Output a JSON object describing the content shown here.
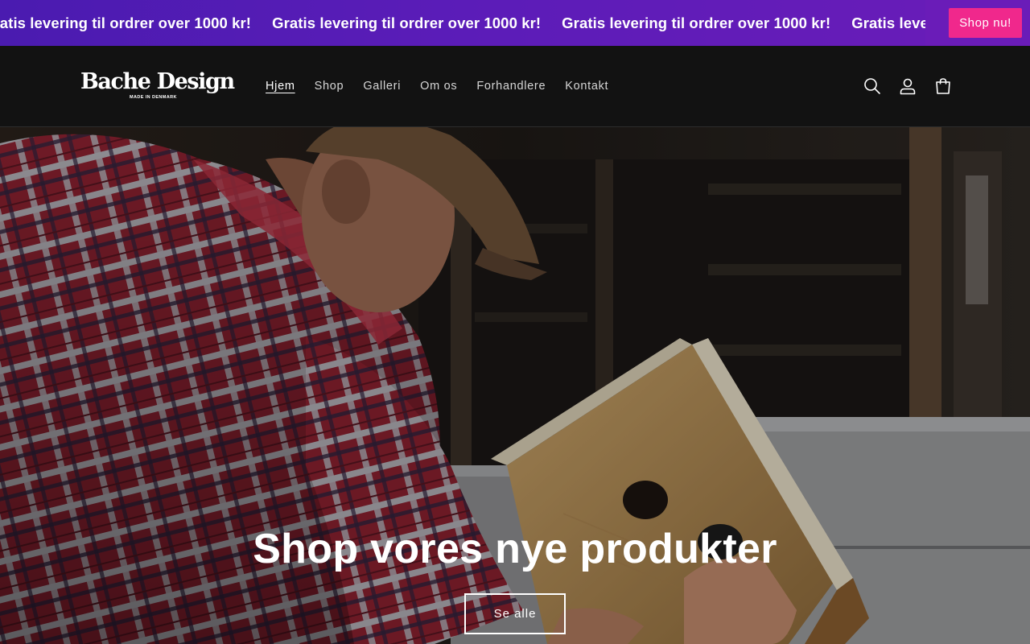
{
  "announcement": {
    "messages": [
      "Gratis levering til ordrer over 1000 kr!",
      "Gratis levering til ordrer over 1000 kr!",
      "Gratis levering til ordrer over 1000 kr!",
      "Gratis levering til ordrer over 1000 kr!"
    ],
    "cta_label": "Shop nu!",
    "cta_color": "#f0288c",
    "bar_color": "#5b1cb8"
  },
  "header": {
    "logo_text": "Bache Design",
    "logo_subtext": "MADE IN DENMARK",
    "nav": [
      {
        "label": "Hjem",
        "active": true
      },
      {
        "label": "Shop"
      },
      {
        "label": "Galleri"
      },
      {
        "label": "Om os"
      },
      {
        "label": "Forhandlere"
      },
      {
        "label": "Kontakt"
      }
    ],
    "icons": [
      "search-icon",
      "account-icon",
      "cart-icon"
    ]
  },
  "hero": {
    "title": "Shop vores nye produkter",
    "button_label": "Se alle"
  }
}
